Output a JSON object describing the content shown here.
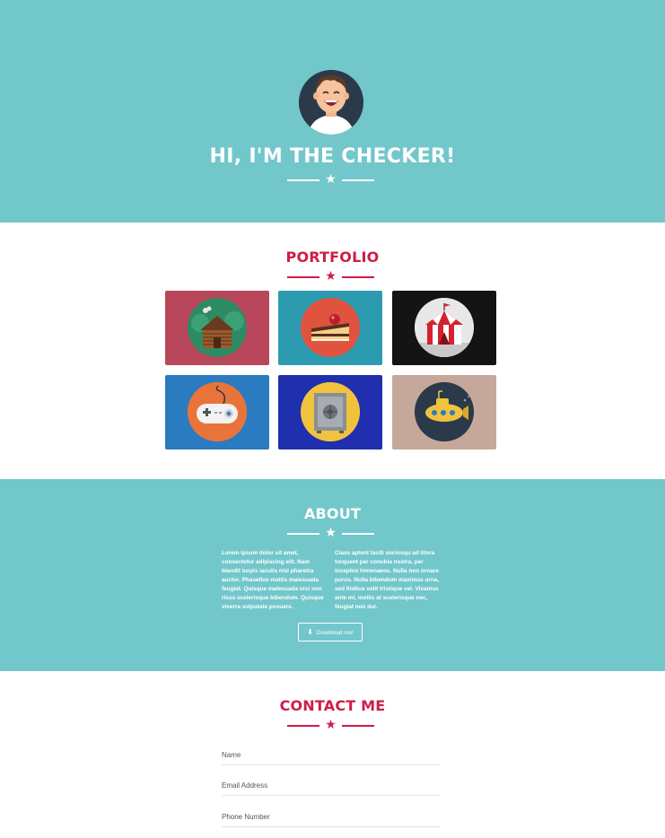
{
  "hero": {
    "title": "HI, I'M THE CHECKER!",
    "avatar_icon": "avatar-icon",
    "background_color": "#72c7cb"
  },
  "portfolio": {
    "title": "PORTFOLIO",
    "accent_color": "#d01c48",
    "items": [
      {
        "icon": "cabin-icon",
        "color": "#b8475b",
        "circle_color": "#2e8a63"
      },
      {
        "icon": "cake-icon",
        "color": "#2c9bb0",
        "circle_color": "#e0533f"
      },
      {
        "icon": "circus-tent-icon",
        "color": "#141414",
        "circle_color": "#e8e8e8"
      },
      {
        "icon": "game-controller-icon",
        "color": "#2b7bc0",
        "circle_color": "#e8743b"
      },
      {
        "icon": "safe-icon",
        "color": "#1f2fad",
        "circle_color": "#f0c23e"
      },
      {
        "icon": "submarine-icon",
        "color": "#c6a89a",
        "circle_color": "#2b3a4a"
      }
    ]
  },
  "about": {
    "title": "ABOUT",
    "col1": "Lorem ipsum dolor sit amet, consectetur adipiscing elit. Nam blandit turpis iaculis nisl pharetra auctor. Phasellus mattis malesuada feugiat. Quisque malesuada orci non risus scelerisque bibendum. Quisque viverra vulputate posuere.",
    "col2": "Class aptent taciti sociosqu ad litora torquent per conubia nostra, per inceptos himenaeos. Nulla non ornare purus. Nulla bibendum maximus urna, sed finibus velit tristique vel. Vivamus ante mi, mollis at scelerisque nec, feugiat non dui.",
    "download_label": "Download me!",
    "download_icon": "download-icon"
  },
  "contact": {
    "title": "CONTACT ME",
    "fields": [
      {
        "placeholder": "Name"
      },
      {
        "placeholder": "Email Address"
      },
      {
        "placeholder": "Phone Number"
      }
    ]
  }
}
